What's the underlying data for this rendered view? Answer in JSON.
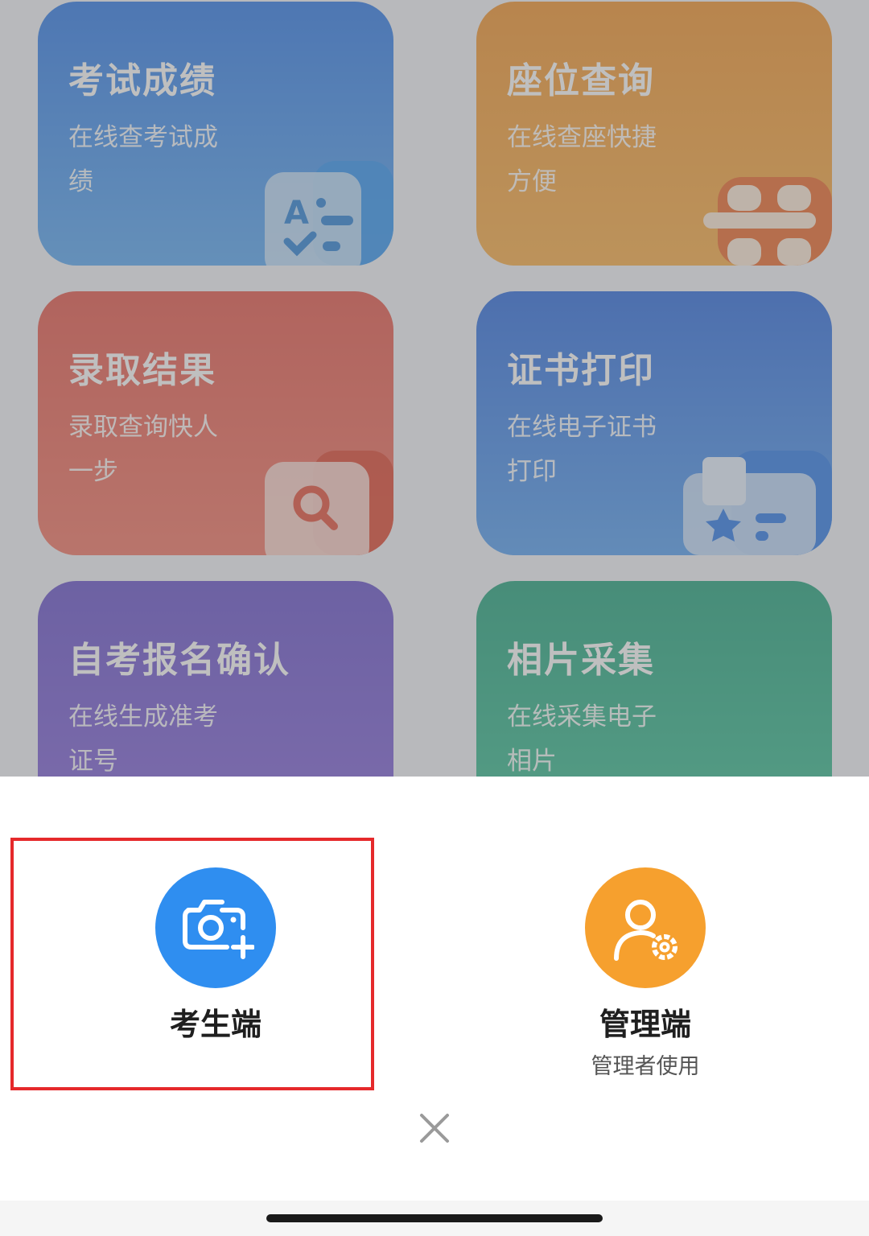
{
  "cards": [
    {
      "title": "考试成绩",
      "desc": "在线查考试成绩"
    },
    {
      "title": "座位查询",
      "desc": "在线查座快捷方便"
    },
    {
      "title": "录取结果",
      "desc": "录取查询快人一步"
    },
    {
      "title": "证书打印",
      "desc": "在线电子证书打印"
    },
    {
      "title": "自考报名确认",
      "desc": "在线生成准考证号"
    },
    {
      "title": "相片采集",
      "desc": "在线采集电子相片"
    }
  ],
  "sheet": {
    "student": {
      "label": "考生端",
      "icon": "camera-plus-icon",
      "color": "#2f8ef0"
    },
    "admin": {
      "label": "管理端",
      "sub": "管理者使用",
      "icon": "user-settings-icon",
      "color": "#f6a02e"
    },
    "highlight_color": "#e5292b",
    "close_icon": "close-icon"
  }
}
